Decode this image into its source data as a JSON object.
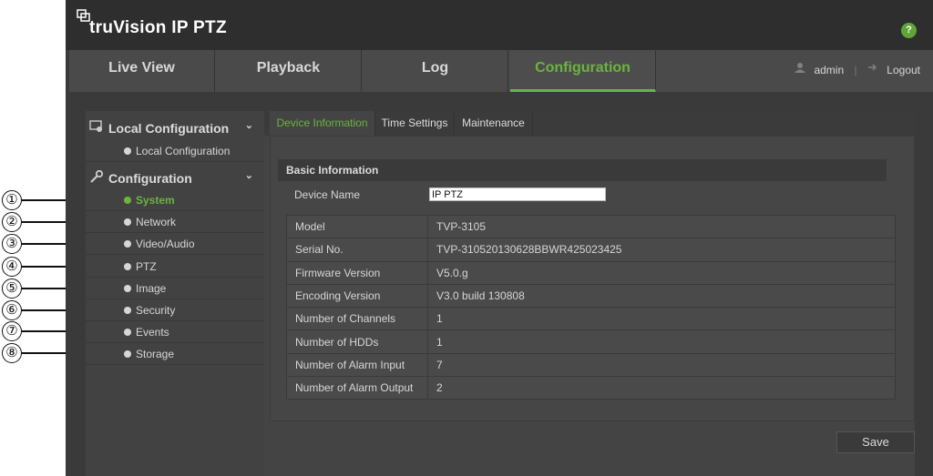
{
  "app": {
    "brand": "truVision IP PTZ"
  },
  "nav": {
    "tabs": [
      {
        "label": "Live View"
      },
      {
        "label": "Playback"
      },
      {
        "label": "Log"
      },
      {
        "label": "Configuration"
      }
    ],
    "user": "admin",
    "logout": "Logout"
  },
  "menu": {
    "local_head": "Local Configuration",
    "local_items": [
      {
        "label": "Local Configuration"
      }
    ],
    "config_head": "Configuration",
    "items": [
      {
        "label": "System"
      },
      {
        "label": "Network"
      },
      {
        "label": "Video/Audio"
      },
      {
        "label": "PTZ"
      },
      {
        "label": "Image"
      },
      {
        "label": "Security"
      },
      {
        "label": "Events"
      },
      {
        "label": "Storage"
      }
    ]
  },
  "callouts": [
    "①",
    "②",
    "③",
    "④",
    "⑤",
    "⑥",
    "⑦",
    "⑧"
  ],
  "content": {
    "subtabs": [
      {
        "label": "Device Information"
      },
      {
        "label": "Time Settings"
      },
      {
        "label": "Maintenance"
      }
    ],
    "section_title": "Basic Information",
    "device_name_label": "Device Name",
    "device_name_value": "IP PTZ",
    "rows": [
      {
        "key": "Model",
        "value": "TVP-3105"
      },
      {
        "key": "Serial No.",
        "value": "TVP-310520130628BBWR425023425"
      },
      {
        "key": "Firmware Version",
        "value": "V5.0.g"
      },
      {
        "key": "Encoding Version",
        "value": "V3.0 build 130808"
      },
      {
        "key": "Number of Channels",
        "value": "1"
      },
      {
        "key": "Number of HDDs",
        "value": "1"
      },
      {
        "key": "Number of Alarm Input",
        "value": "7"
      },
      {
        "key": "Number of Alarm Output",
        "value": "2"
      }
    ],
    "save_label": "Save"
  }
}
